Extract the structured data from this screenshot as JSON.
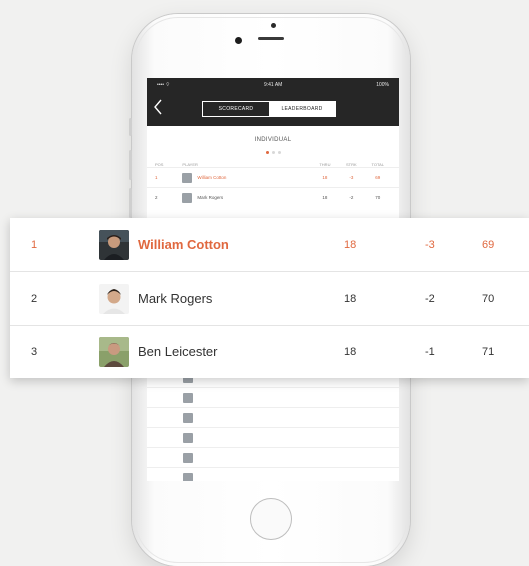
{
  "colors": {
    "accent": "#e0683f",
    "nav_background": "#262626",
    "text": "#333333",
    "page_background": "#f1f1f0"
  },
  "status_bar": {
    "carrier": "•••• ⌔",
    "time": "9:41 AM",
    "battery": "100%"
  },
  "nav": {
    "back_icon": "chevron-left-icon",
    "tabs": [
      {
        "label": "SCORECARD",
        "selected": false
      },
      {
        "label": "LEADERBOARD",
        "selected": true
      }
    ]
  },
  "leaderboard": {
    "section_title": "INDIVIDUAL",
    "page_dots": {
      "count": 3,
      "active": 0
    },
    "columns": {
      "pos": "POS",
      "player": "PLAYER",
      "thru": "THRU",
      "strokes": "STRK",
      "total": "TOTAL"
    },
    "highlighted_rows": [
      {
        "pos": "1",
        "name": "William Cotton",
        "thru": "18",
        "strokes": "-3",
        "total": "69",
        "highlight": true
      },
      {
        "pos": "2",
        "name": "Mark Rogers",
        "thru": "18",
        "strokes": "-2",
        "total": "70",
        "highlight": false
      },
      {
        "pos": "3",
        "name": "Ben Leicester",
        "thru": "18",
        "strokes": "-1",
        "total": "71",
        "highlight": false
      }
    ]
  }
}
